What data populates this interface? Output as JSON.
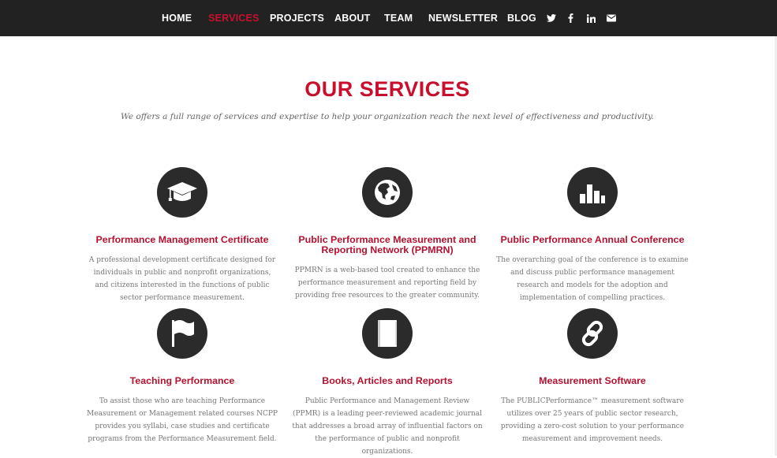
{
  "nav": {
    "items": [
      {
        "label": "HOME",
        "active": false
      },
      {
        "label": "SERVICES",
        "active": true
      },
      {
        "label": "PROJECTS",
        "active": false
      },
      {
        "label": "ABOUT",
        "active": false
      },
      {
        "label": "TEAM",
        "active": false
      },
      {
        "label": "NEWSLETTER",
        "active": false
      },
      {
        "label": "BLOG",
        "active": false
      }
    ],
    "social_icons": [
      "twitter-icon",
      "facebook-icon",
      "linkedin-icon",
      "envelope-icon"
    ]
  },
  "colors": {
    "accent": "#c8102e",
    "card_title": "#b31230",
    "navbar": "#222222",
    "icon_circle": "#2b2b2b"
  },
  "header": {
    "title": "OUR SERVICES",
    "subtitle": "We offers a full range of services and expertise to help your organization reach the next level of effectiveness and productivity."
  },
  "services": [
    {
      "icon": "graduation-cap-icon",
      "title": "Performance Management Certificate",
      "description": "A professional development certificate designed for individuals in public and nonprofit organizations, and citizens interested in the functions of public sector performance measurement."
    },
    {
      "icon": "globe-icon",
      "title": "Public Performance Measurement and Reporting Network (PPMRN)",
      "description": "PPMRN is a web-based tool created to enhance the performance measurement and reporting field by providing free resources to the greater community."
    },
    {
      "icon": "bar-chart-icon",
      "title": "Public Performance Annual Conference",
      "description": "The overarching goal of the conference is to examine and discuss public performance management research and models for the adoption and implementation of compelling practices."
    },
    {
      "icon": "flag-icon",
      "title": "Teaching Performance",
      "description": "To assist those who are teaching Performance Measurement or Management related courses NCPP provides you syllabi, case studies and certificate programs from the Performance Measurement field."
    },
    {
      "icon": "book-icon",
      "title": "Books, Articles and Reports",
      "description": "Public Performance and Management Review (PPMR) is a leading peer-reviewed academic journal that addresses a broad array of influential factors on the performance of public and nonprofit organizations."
    },
    {
      "icon": "link-icon",
      "title": "Measurement Software",
      "description": "The PUBLICPerformance™ measurement software utilizes over 25 years of public sector research, providing a zero-cost solution to your performance measurement and improvement needs."
    }
  ]
}
